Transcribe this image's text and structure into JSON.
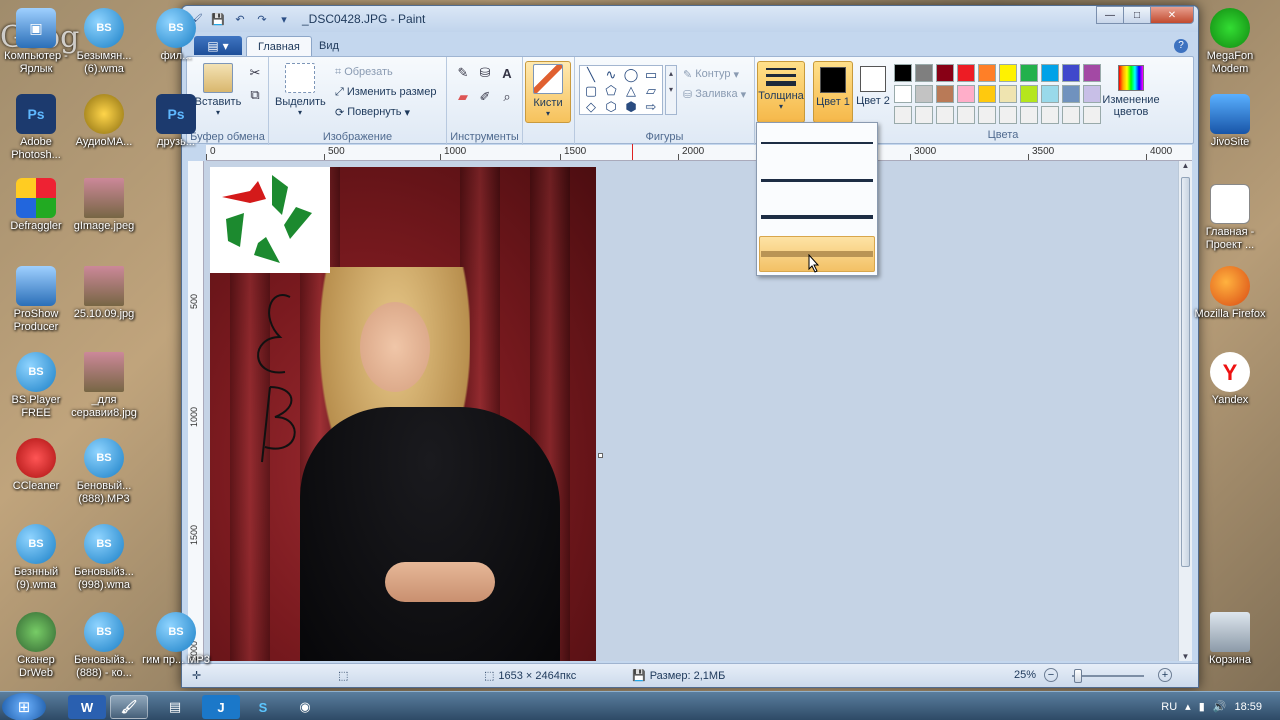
{
  "desktop": {
    "overlay_text": "Goog",
    "icons_left": [
      {
        "label": "Компьютер - Ярлык",
        "icon": "computer-icon"
      },
      {
        "label": "Adobe Photosh...",
        "icon": "photoshop-icon"
      },
      {
        "label": "Defraggler",
        "icon": "defraggler-icon"
      },
      {
        "label": "ProShow Producer",
        "icon": "proshow-icon"
      },
      {
        "label": "BS.Player FREE",
        "icon": "bsplayer-icon"
      },
      {
        "label": "CCleaner",
        "icon": "ccleaner-icon"
      },
      {
        "label": "Безнный (9).wma",
        "icon": "bsplayer-icon"
      },
      {
        "label": "Сканер DrWeb",
        "icon": "scanner-icon"
      }
    ],
    "icons_col2": [
      {
        "label": "Безымян... (6).wma",
        "icon": "bsplayer-icon"
      },
      {
        "label": "АудиоМА...",
        "icon": "audio-icon"
      },
      {
        "label": "gImage.jpeg",
        "icon": "image-icon"
      },
      {
        "label": "25.10.09.jpg",
        "icon": "image-icon"
      },
      {
        "label": "_для серавии8.jpg",
        "icon": "image-icon"
      },
      {
        "label": "Беновый... (888).MP3",
        "icon": "bsplayer-icon"
      },
      {
        "label": "Беновыйз... (998).wma",
        "icon": "bsplayer-icon"
      },
      {
        "label": "Беновыйз... (888) - ко...",
        "icon": "bsplayer-icon"
      }
    ],
    "icons_col3": [
      {
        "label": "фил...",
        "icon": "bsplayer-icon"
      },
      {
        "label": "друзь...",
        "icon": "photoshop-icon"
      },
      {
        "label": "гим пр... MP3",
        "icon": "bsplayer-icon"
      }
    ],
    "icons_right": [
      {
        "label": "MegaFon Modem",
        "icon": "megafon-icon"
      },
      {
        "label": "JivoSite",
        "icon": "jivosite-icon"
      },
      {
        "label": "Главная - Проект ...",
        "icon": "document-icon"
      },
      {
        "label": "Mozilla Firefox",
        "icon": "firefox-icon"
      },
      {
        "label": "Yandex",
        "icon": "yandex-icon"
      },
      {
        "label": "Корзина",
        "icon": "recycle-bin-icon"
      }
    ]
  },
  "window": {
    "title": "_DSC0428.JPG - Paint",
    "controls": {
      "minimize": "—",
      "maximize": "□",
      "close": "✕"
    }
  },
  "tabs": {
    "paint_menu": "▾",
    "home": "Главная",
    "view": "Вид"
  },
  "ribbon": {
    "clipboard": {
      "label": "Буфер обмена",
      "paste": "Вставить"
    },
    "image": {
      "label": "Изображение",
      "select": "Выделить",
      "crop": "Обрезать",
      "resize": "Изменить размер",
      "rotate": "Повернуть"
    },
    "tools": {
      "label": "Инструменты"
    },
    "brushes": {
      "label": "Кисти"
    },
    "shapes": {
      "label": "Фигуры",
      "outline": "Контур",
      "fill": "Заливка",
      "glyphs": [
        "╲",
        "∿",
        "◯",
        "▭",
        "▢",
        "⬠",
        "△",
        "▱",
        "◇",
        "⬡",
        "⬢",
        "⇨"
      ]
    },
    "size": {
      "label": "Толщина"
    },
    "colors": {
      "label": "Цвета",
      "color1": "Цвет 1",
      "color2": "Цвет 2",
      "edit": "Изменение цветов",
      "color1_value": "#000000",
      "color2_value": "#ffffff",
      "palette": [
        "#000000",
        "#7f7f7f",
        "#880015",
        "#ed1c24",
        "#ff7f27",
        "#fff200",
        "#22b14c",
        "#00a2e8",
        "#3f48cc",
        "#a349a4",
        "#ffffff",
        "#c3c3c3",
        "#b97a57",
        "#ffaec9",
        "#ffc90e",
        "#efe4b0",
        "#b5e61d",
        "#99d9ea",
        "#7092be",
        "#c8bfe7",
        "#f0f0f0",
        "#f0f0f0",
        "#f0f0f0",
        "#f0f0f0",
        "#f0f0f0",
        "#f0f0f0",
        "#f0f0f0",
        "#f0f0f0",
        "#f0f0f0",
        "#f0f0f0"
      ]
    }
  },
  "ruler": {
    "h_labels": [
      "0",
      "500",
      "1000",
      "1500",
      "2000",
      "3000",
      "3500",
      "4000"
    ],
    "v_labels": [
      "500",
      "1000",
      "1500",
      "2000"
    ]
  },
  "status": {
    "dimensions": "1653 × 2464пкс",
    "size": "Размер: 2,1МБ",
    "zoom": "25%",
    "zoom_minus": "−",
    "zoom_plus": "+"
  },
  "thickness_menu": {
    "options": [
      1,
      2,
      3,
      5
    ],
    "hovered_index": 3
  },
  "taskbar": {
    "lang": "RU",
    "time": "18:59"
  }
}
